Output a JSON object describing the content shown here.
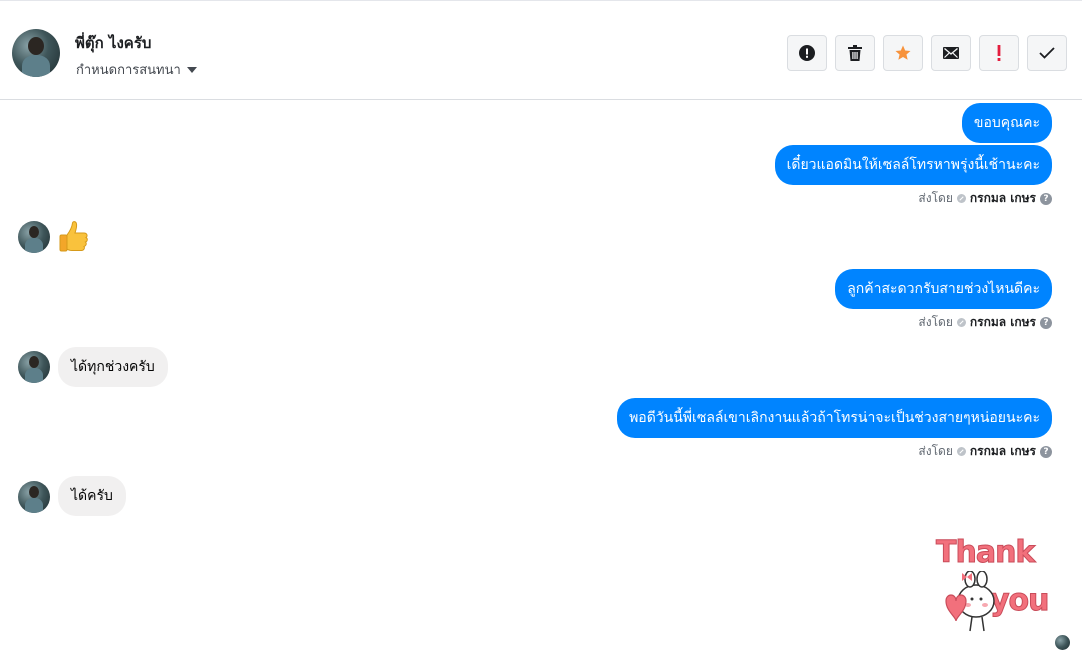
{
  "header": {
    "contact_name": "พี่ตุ๊ก ไงครับ",
    "conversation_settings": "กำหนดการสนทนา",
    "toolbar": [
      {
        "name": "report-spam-button",
        "icon": "exclamation-circle-icon",
        "label": "!"
      },
      {
        "name": "delete-button",
        "icon": "trash-icon",
        "label": ""
      },
      {
        "name": "star-button",
        "icon": "star-icon",
        "label": ""
      },
      {
        "name": "mark-unread-button",
        "icon": "envelope-icon",
        "label": ""
      },
      {
        "name": "mark-important-button",
        "icon": "exclamation-icon",
        "label": "!"
      },
      {
        "name": "mark-done-button",
        "icon": "check-icon",
        "label": ""
      }
    ]
  },
  "messages": [
    {
      "direction": "out",
      "text": "ขอบคุณคะ"
    },
    {
      "direction": "out",
      "text": "เดี๋ยวแอดมินให้เซลล์โทรหาพรุ่งนี้เช้านะคะ",
      "sent_by_label": "ส่งโดย",
      "sent_by_name": "กรกมล เกษร"
    },
    {
      "direction": "in",
      "emoji": "👍"
    },
    {
      "direction": "out",
      "text": "ลูกค้าสะดวกรับสายช่วงไหนดีคะ",
      "sent_by_label": "ส่งโดย",
      "sent_by_name": "กรกมล เกษร"
    },
    {
      "direction": "in",
      "text": "ได้ทุกช่วงครับ"
    },
    {
      "direction": "out",
      "text": "พอดีวันนี้พี่เซลล์เขาเลิกงานแล้วถ้าโทรน่าจะเป็นช่วงสายๆหน่อยนะคะ",
      "sent_by_label": "ส่งโดย",
      "sent_by_name": "กรกมล เกษร"
    },
    {
      "direction": "in",
      "text": "ได้ครับ"
    },
    {
      "direction": "out",
      "sticker_text_1": "Thank",
      "sticker_text_2": "you"
    }
  ],
  "colors": {
    "outgoing_bubble": "#0084ff",
    "incoming_bubble": "#f1f0f0",
    "star": "#f7923b",
    "important": "#e41e3f"
  }
}
